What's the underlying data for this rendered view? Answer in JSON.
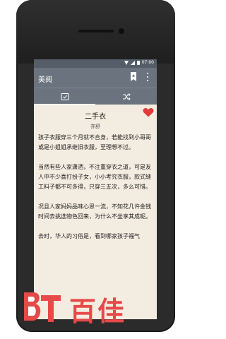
{
  "statusbar": {
    "time": "07:00",
    "icons": [
      "wifi-icon",
      "signal-icon",
      "battery-icon"
    ]
  },
  "toolbar": {
    "title": "美阅",
    "actions": [
      "bookmark-icon",
      "more-vert-icon"
    ]
  },
  "tabs": [
    {
      "name": "reader-tab",
      "icon": "check-list-icon",
      "active": true
    },
    {
      "name": "shuffle-tab",
      "icon": "shuffle-icon",
      "active": false
    }
  ],
  "article": {
    "title": "二手衣",
    "author": "亦舒",
    "paragraphs": [
      "孩子衣服穿三个月就不合身，若能找到小哥哥或是小姐姐承继旧衣服，至理想不过。",
      "当然有些人家潇洒，不注重穿衣之道，可是友人中不少喜打扮子女，小小考究衣服，款式缝工料子都不可多得，只穿三五次，多么可惜。",
      "况且人家妈妈品味心思一流，不知花几许金钱时间去挑选物色回来，为什么不坐享其成呢。",
      "去时，华人的习俗是，看到哪家孩子福气"
    ]
  },
  "watermark": {
    "brand": "百佳",
    "logo_letters": "BT"
  },
  "colors": {
    "toolbar": "#6b747e",
    "statusbar": "#555e68",
    "page": "#f3ece0",
    "heart": "#e23b3b",
    "watermark": "#e74848"
  }
}
